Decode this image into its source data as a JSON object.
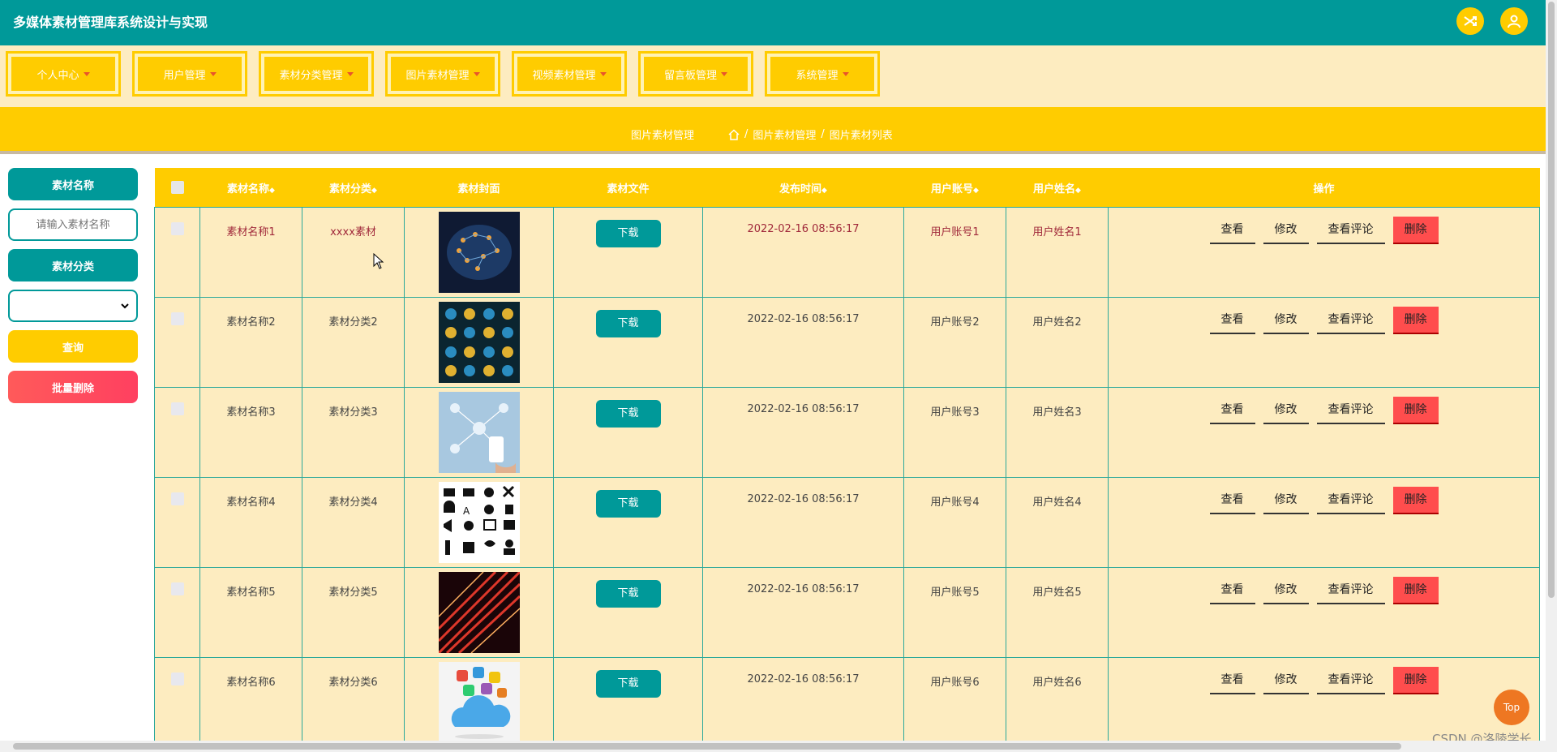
{
  "app": {
    "title": "多媒体素材管理库系统设计与实现"
  },
  "header": {
    "shuffle_icon": "shuffle-icon",
    "user_icon": "user-icon"
  },
  "nav": {
    "items": [
      {
        "label": "个人中心"
      },
      {
        "label": "用户管理"
      },
      {
        "label": "素材分类管理"
      },
      {
        "label": "图片素材管理"
      },
      {
        "label": "视频素材管理"
      },
      {
        "label": "留言板管理"
      },
      {
        "label": "系统管理"
      }
    ]
  },
  "breadcrumb": {
    "current": "图片素材管理",
    "sep": "/",
    "path1": "图片素材管理",
    "path2": "图片素材列表"
  },
  "sidebar": {
    "name_label": "素材名称",
    "name_placeholder": "请输入素材名称",
    "category_label": "素材分类",
    "category_value": "",
    "query_button": "查询",
    "batch_delete_button": "批量删除"
  },
  "table": {
    "headers": [
      "素材名称",
      "素材分类",
      "素材封面",
      "素材文件",
      "发布时间",
      "用户账号",
      "用户姓名",
      "操作"
    ],
    "sort_icon": "◆",
    "rows": [
      {
        "name": "素材名称1",
        "category": "xxxx素材",
        "cover": "cover-digital-brain",
        "file": "下载",
        "time": "2022-02-16 08:56:17",
        "account": "用户账号1",
        "username": "用户姓名1"
      },
      {
        "name": "素材名称2",
        "category": "素材分类2",
        "cover": "cover-icons-grid",
        "file": "下载",
        "time": "2022-02-16 08:56:17",
        "account": "用户账号2",
        "username": "用户姓名2"
      },
      {
        "name": "素材名称3",
        "category": "素材分类3",
        "cover": "cover-network-phone",
        "file": "下载",
        "time": "2022-02-16 08:56:17",
        "account": "用户账号3",
        "username": "用户姓名3"
      },
      {
        "name": "素材名称4",
        "category": "素材分类4",
        "cover": "cover-media-icons",
        "file": "下载",
        "time": "2022-02-16 08:56:17",
        "account": "用户账号4",
        "username": "用户姓名4"
      },
      {
        "name": "素材名称5",
        "category": "素材分类5",
        "cover": "cover-red-light",
        "file": "下载",
        "time": "2022-02-16 08:56:17",
        "account": "用户账号5",
        "username": "用户姓名5"
      },
      {
        "name": "素材名称6",
        "category": "素材分类6",
        "cover": "cover-cloud-apps",
        "file": "下载",
        "time": "2022-02-16 08:56:17",
        "account": "用户账号6",
        "username": "用户姓名6"
      }
    ],
    "actions": {
      "view": "查看",
      "edit": "修改",
      "comments": "查看评论",
      "delete": "删除"
    }
  },
  "top_button": "Top",
  "watermark": "CSDN @洛陵学长",
  "colors": {
    "header": "#009999",
    "accent": "#ffcc00",
    "row_bg": "#fdecc0",
    "danger": "#ff4d4d",
    "top_button": "#ee7722"
  }
}
